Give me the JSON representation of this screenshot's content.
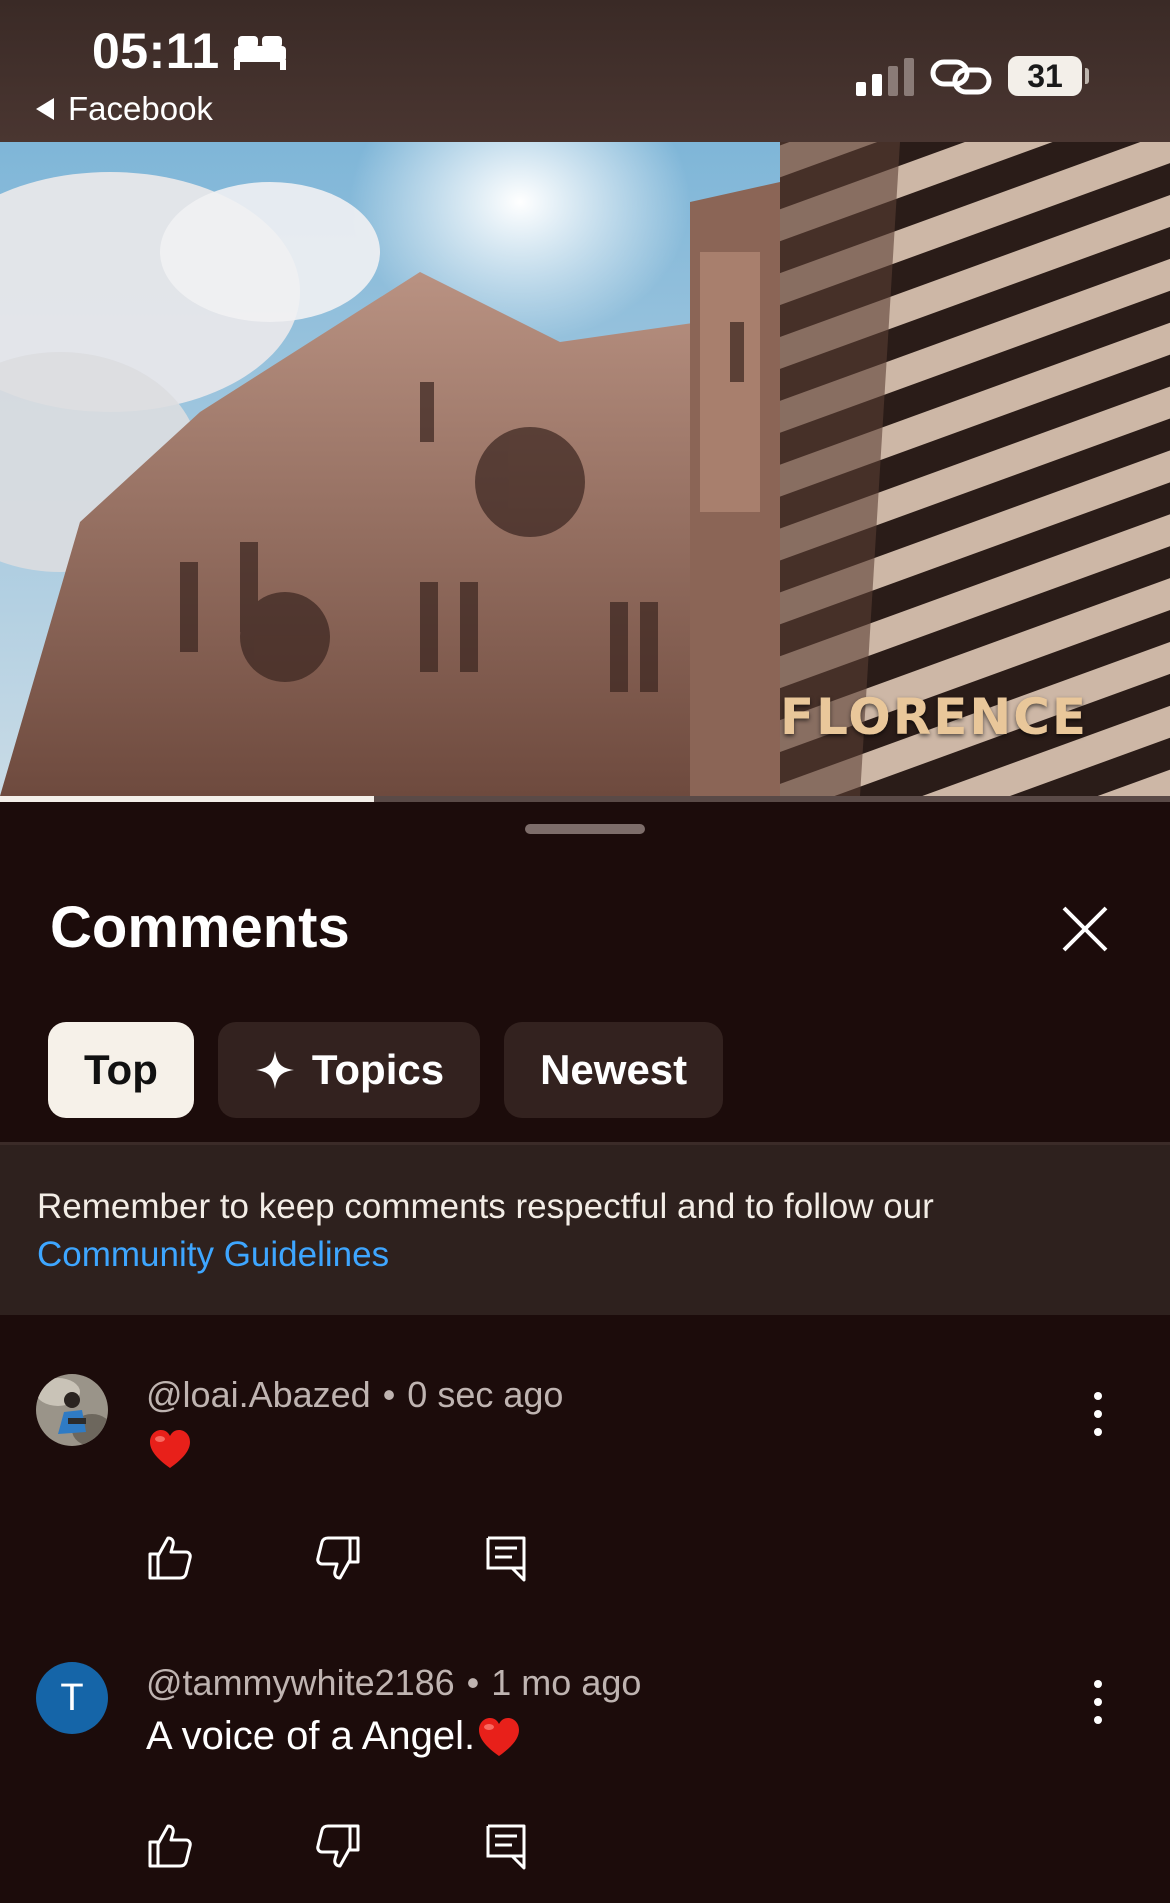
{
  "status_bar": {
    "time": "05:11",
    "back_app": "Facebook",
    "battery": "31",
    "icons": [
      "bed-icon",
      "signal-icon",
      "link-icon",
      "battery-icon"
    ]
  },
  "video": {
    "overlay_title": "FLORENCE",
    "progress": 0.32
  },
  "comments_panel": {
    "title": "Comments",
    "chips": [
      {
        "label": "Top",
        "active": true
      },
      {
        "label": "Topics",
        "active": false,
        "icon": "sparkle-icon"
      },
      {
        "label": "Newest",
        "active": false
      }
    ],
    "notice": {
      "text": "Remember to keep comments respectful and to follow our",
      "link": "Community Guidelines"
    },
    "comments": [
      {
        "author": "@loai.Abazed",
        "time": "0 sec ago",
        "text": "",
        "emoji": "red-heart",
        "avatar": "photo"
      },
      {
        "author": "@tammywhite2186",
        "time": "1 mo ago",
        "text": "A voice of a Angel.",
        "emoji": "red-heart",
        "avatar_letter": "T"
      }
    ],
    "separator": "•"
  },
  "colors": {
    "background": "#1c0c0b",
    "chip_bg": "#33221f",
    "chip_active_bg": "#f6f1e9",
    "link": "#3ea6ff",
    "avatar_t": "#1565a8"
  }
}
